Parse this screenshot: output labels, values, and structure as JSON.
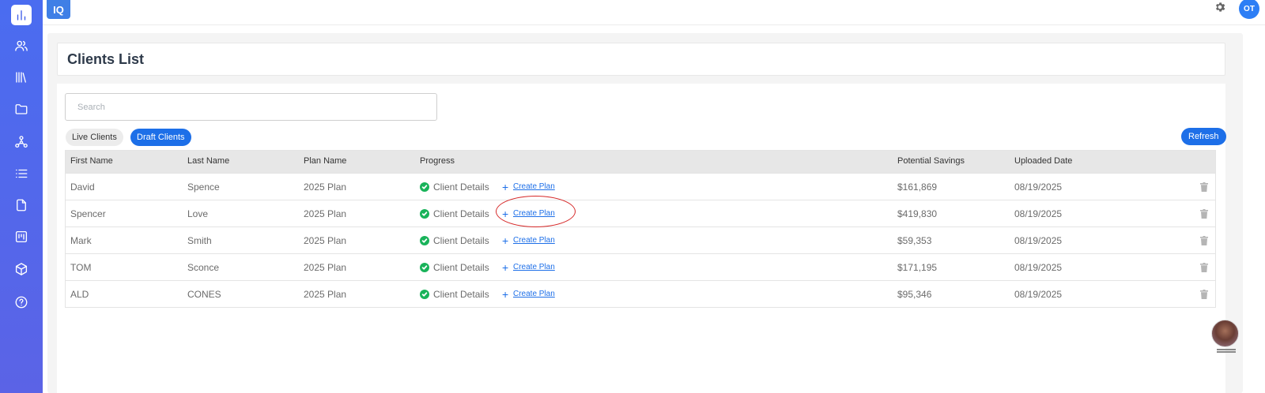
{
  "brand": {
    "logo_text": "IQ"
  },
  "user": {
    "initials": "OT"
  },
  "page": {
    "title": "Clients List"
  },
  "search": {
    "placeholder": "Search",
    "value": ""
  },
  "tabs": [
    {
      "label": "Live Clients",
      "active": false
    },
    {
      "label": "Draft Clients",
      "active": true
    }
  ],
  "refresh_label": "Refresh",
  "table": {
    "headers": {
      "first_name": "First Name",
      "last_name": "Last Name",
      "plan_name": "Plan Name",
      "progress": "Progress",
      "potential_savings": "Potential Savings",
      "uploaded_date": "Uploaded Date"
    },
    "rows": [
      {
        "first": "David",
        "last": "Spence",
        "plan": "2025 Plan",
        "step": "Client Details",
        "action": "Create Plan",
        "savings": "$161,869",
        "date": "08/19/2025"
      },
      {
        "first": "Spencer",
        "last": "Love",
        "plan": "2025 Plan",
        "step": "Client Details",
        "action": "Create Plan",
        "savings": "$419,830",
        "date": "08/19/2025"
      },
      {
        "first": "Mark",
        "last": "Smith",
        "plan": "2025 Plan",
        "step": "Client Details",
        "action": "Create Plan",
        "savings": "$59,353",
        "date": "08/19/2025"
      },
      {
        "first": "TOM",
        "last": "Sconce",
        "plan": "2025 Plan",
        "step": "Client Details",
        "action": "Create Plan",
        "savings": "$171,195",
        "date": "08/19/2025"
      },
      {
        "first": "ALD",
        "last": "CONES",
        "plan": "2025 Plan",
        "step": "Client Details",
        "action": "Create Plan",
        "savings": "$95,346",
        "date": "08/19/2025"
      }
    ]
  },
  "sidebar": {
    "items": [
      {
        "icon": "bar-chart-icon",
        "active": true
      },
      {
        "icon": "users-icon",
        "active": false
      },
      {
        "icon": "library-icon",
        "active": false
      },
      {
        "icon": "folder-icon",
        "active": false
      },
      {
        "icon": "network-icon",
        "active": false
      },
      {
        "icon": "list-icon",
        "active": false
      },
      {
        "icon": "document-icon",
        "active": false
      },
      {
        "icon": "board-icon",
        "active": false
      },
      {
        "icon": "cube-icon",
        "active": false
      },
      {
        "icon": "help-icon",
        "active": false
      }
    ]
  },
  "colors": {
    "sidebar": "#4a6cf0",
    "primary": "#1d6fe8",
    "success": "#19b35a",
    "highlight": "#d62828"
  }
}
